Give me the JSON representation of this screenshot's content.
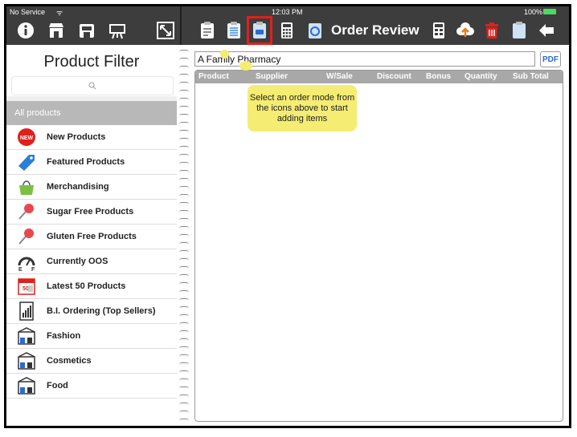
{
  "status": {
    "carrier": "No Service",
    "time": "12:03 PM",
    "battery": "100%"
  },
  "toolbar": {
    "title": "Order Review",
    "left_icons": [
      "info-icon",
      "store-icon",
      "shop-icon",
      "presentation-icon",
      "resize-icon"
    ],
    "right_icons": [
      "clipboard-edit-icon",
      "clipboard-list-icon",
      "clipboard-order-icon",
      "calculator-icon",
      "sync-icon",
      "calculator-alt-icon",
      "cloud-upload-icon",
      "trash-icon",
      "clipboard-icon",
      "back-arrow-icon"
    ]
  },
  "filter": {
    "title": "Product Filter",
    "search_placeholder": "",
    "all_products": "All products",
    "items": [
      {
        "label": "New Products",
        "icon": "new-badge-icon"
      },
      {
        "label": "Featured Products",
        "icon": "tag-icon"
      },
      {
        "label": "Merchandising",
        "icon": "bag-icon"
      },
      {
        "label": "Sugar Free Products",
        "icon": "pin-icon"
      },
      {
        "label": "Gluten Free Products",
        "icon": "pin-icon"
      },
      {
        "label": "Currently OOS",
        "icon": "gauge-icon"
      },
      {
        "label": "Latest 50 Products",
        "icon": "calendar-icon"
      },
      {
        "label": "B.I. Ordering (Top Sellers)",
        "icon": "report-icon"
      },
      {
        "label": "Fashion",
        "icon": "box-icon"
      },
      {
        "label": "Cosmetics",
        "icon": "box-icon"
      },
      {
        "label": "Food",
        "icon": "box-icon"
      }
    ]
  },
  "order": {
    "customer": "A Family Pharmacy",
    "pdf_label": "PDF",
    "columns": [
      "Product",
      "Supplier",
      "W/Sale",
      "Discount",
      "Bonus",
      "Quantity",
      "Sub Total"
    ],
    "tip": "Select an order mode from the icons above to start adding items"
  },
  "colors": {
    "toolbar_bg": "#3d3d3d",
    "highlight": "#e0201c",
    "tip_bg": "#f5ec73",
    "header_bg": "#a8a8a8"
  }
}
